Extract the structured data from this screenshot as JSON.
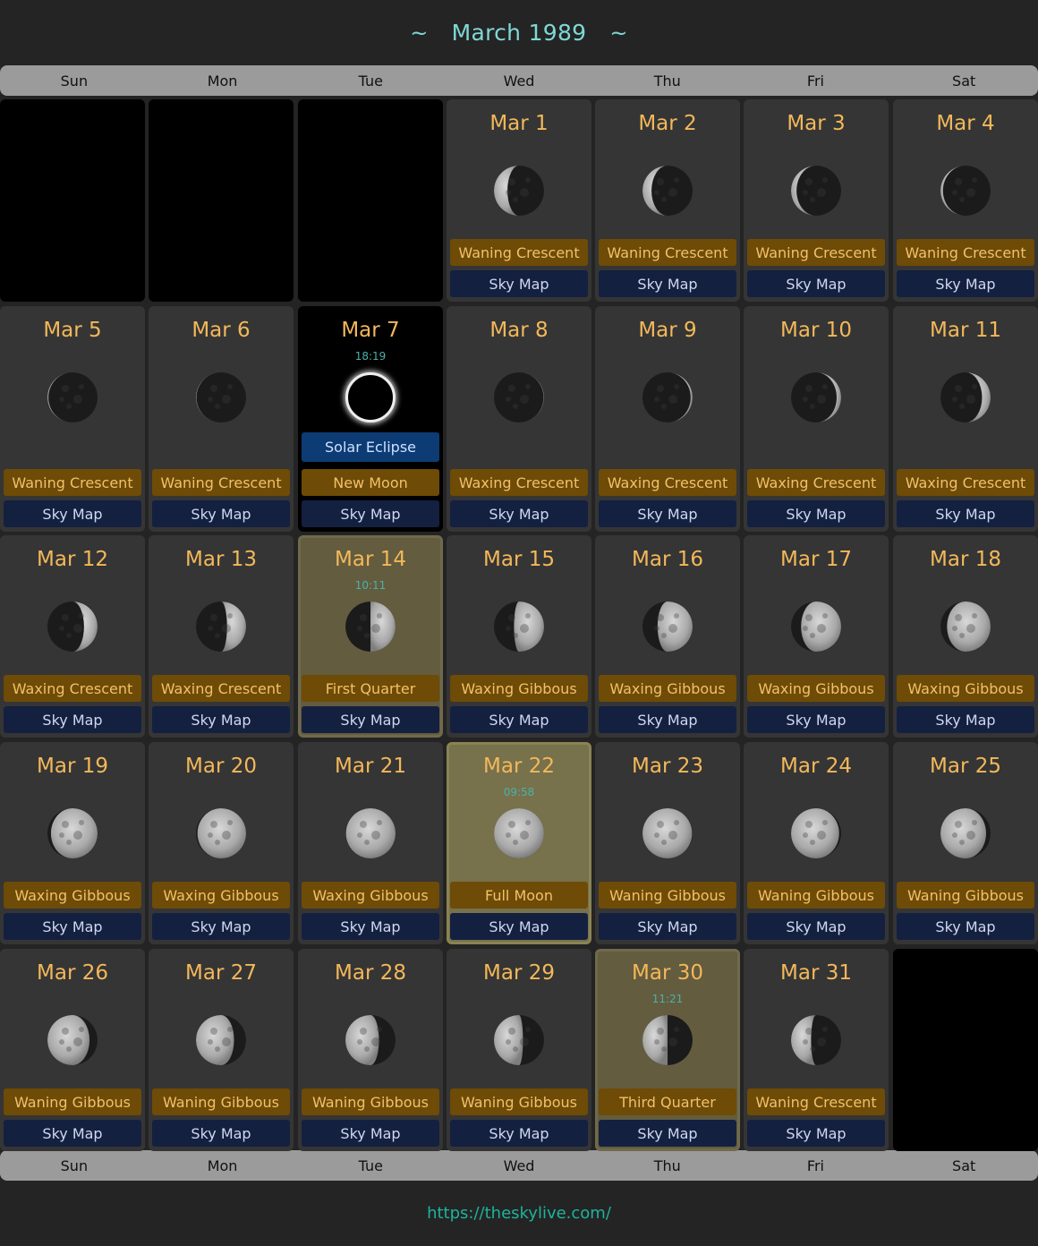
{
  "title": "March 1989",
  "title_deco": "~",
  "weekdays": [
    "Sun",
    "Mon",
    "Tue",
    "Wed",
    "Thu",
    "Fri",
    "Sat"
  ],
  "sky_map_label": "Sky Map",
  "footer_link": "https://theskylive.com/",
  "colors": {
    "title": "#7fd8d4",
    "date": "#f3b85a",
    "phase_bg": "#6e4b06",
    "sky_bg": "#142040",
    "eclipse_bg": "#0d3b74",
    "link": "#1eb39d"
  },
  "days": [
    {
      "date": "Mar 1",
      "phase": "Waning Crescent",
      "illum": 0.27,
      "waxing": false
    },
    {
      "date": "Mar 2",
      "phase": "Waning Crescent",
      "illum": 0.18,
      "waxing": false
    },
    {
      "date": "Mar 3",
      "phase": "Waning Crescent",
      "illum": 0.11,
      "waxing": false
    },
    {
      "date": "Mar 4",
      "phase": "Waning Crescent",
      "illum": 0.05,
      "waxing": false
    },
    {
      "date": "Mar 5",
      "phase": "Waning Crescent",
      "illum": 0.02,
      "waxing": false
    },
    {
      "date": "Mar 6",
      "phase": "Waning Crescent",
      "illum": 0.01,
      "waxing": false
    },
    {
      "date": "Mar 7",
      "phase": "New Moon",
      "time": "18:19",
      "event": "Solar Eclipse",
      "illum": 0,
      "waxing": true
    },
    {
      "date": "Mar 8",
      "phase": "Waxing Crescent",
      "illum": 0.01,
      "waxing": true
    },
    {
      "date": "Mar 9",
      "phase": "Waxing Crescent",
      "illum": 0.04,
      "waxing": true
    },
    {
      "date": "Mar 10",
      "phase": "Waxing Crescent",
      "illum": 0.09,
      "waxing": true
    },
    {
      "date": "Mar 11",
      "phase": "Waxing Crescent",
      "illum": 0.17,
      "waxing": true
    },
    {
      "date": "Mar 12",
      "phase": "Waxing Crescent",
      "illum": 0.27,
      "waxing": true
    },
    {
      "date": "Mar 13",
      "phase": "Waxing Crescent",
      "illum": 0.38,
      "waxing": true
    },
    {
      "date": "Mar 14",
      "phase": "First Quarter",
      "time": "10:11",
      "illum": 0.5,
      "waxing": true
    },
    {
      "date": "Mar 15",
      "phase": "Waxing Gibbous",
      "illum": 0.6,
      "waxing": true
    },
    {
      "date": "Mar 16",
      "phase": "Waxing Gibbous",
      "illum": 0.7,
      "waxing": true
    },
    {
      "date": "Mar 17",
      "phase": "Waxing Gibbous",
      "illum": 0.8,
      "waxing": true
    },
    {
      "date": "Mar 18",
      "phase": "Waxing Gibbous",
      "illum": 0.87,
      "waxing": true
    },
    {
      "date": "Mar 19",
      "phase": "Waxing Gibbous",
      "illum": 0.93,
      "waxing": true
    },
    {
      "date": "Mar 20",
      "phase": "Waxing Gibbous",
      "illum": 0.97,
      "waxing": true
    },
    {
      "date": "Mar 21",
      "phase": "Waxing Gibbous",
      "illum": 0.99,
      "waxing": true
    },
    {
      "date": "Mar 22",
      "phase": "Full Moon",
      "time": "09:58",
      "illum": 1,
      "waxing": true
    },
    {
      "date": "Mar 23",
      "phase": "Waning Gibbous",
      "illum": 0.99,
      "waxing": false
    },
    {
      "date": "Mar 24",
      "phase": "Waning Gibbous",
      "illum": 0.96,
      "waxing": false
    },
    {
      "date": "Mar 25",
      "phase": "Waning Gibbous",
      "illum": 0.91,
      "waxing": false
    },
    {
      "date": "Mar 26",
      "phase": "Waning Gibbous",
      "illum": 0.84,
      "waxing": false
    },
    {
      "date": "Mar 27",
      "phase": "Waning Gibbous",
      "illum": 0.76,
      "waxing": false
    },
    {
      "date": "Mar 28",
      "phase": "Waning Gibbous",
      "illum": 0.67,
      "waxing": false
    },
    {
      "date": "Mar 29",
      "phase": "Waning Gibbous",
      "illum": 0.58,
      "waxing": false
    },
    {
      "date": "Mar 30",
      "phase": "Third Quarter",
      "time": "11:21",
      "illum": 0.5,
      "waxing": false
    },
    {
      "date": "Mar 31",
      "phase": "Waning Crescent",
      "illum": 0.4,
      "waxing": false
    }
  ]
}
